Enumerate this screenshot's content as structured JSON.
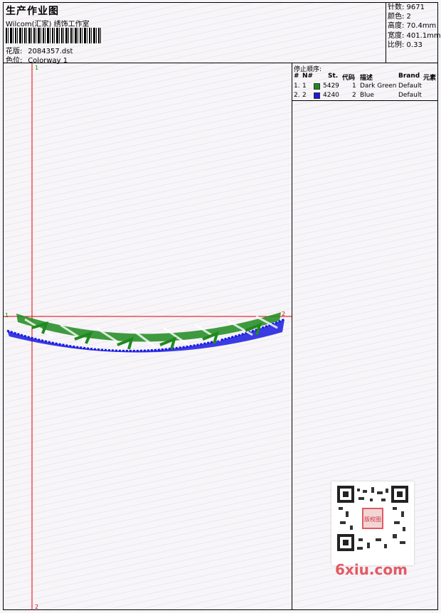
{
  "header": {
    "title": "生产作业图",
    "company": "Wilcom(汇家) 绣饰工作室",
    "design_label": "花版:",
    "design_value": "2084357.dst",
    "colorway_label": "色位:",
    "colorway_value": "Colorway 1"
  },
  "stats": {
    "stitches": "针数: 9671",
    "colors": "颜色: 2",
    "height": "高度: 70.4mm",
    "width": "宽度: 401.1mm",
    "scale": "比例: 0.33"
  },
  "canvas": {
    "marker_top": "1",
    "marker_bottom": "2",
    "marker_left": "1",
    "marker_right": "2"
  },
  "stop_sequence": {
    "title": "停止顺序:",
    "columns": [
      "#",
      "N#",
      "St.",
      "代码",
      "描述",
      "Brand",
      "元素"
    ],
    "rows": [
      {
        "idx": "1.",
        "n": "1",
        "color": "#1f8a1f",
        "st": "5429",
        "code": "1",
        "desc": "Dark Green",
        "brand": "Default"
      },
      {
        "idx": "2.",
        "n": "2",
        "color": "#1a1ae0",
        "st": "4240",
        "code": "2",
        "desc": "Blue",
        "brand": "Default"
      }
    ]
  },
  "watermark": {
    "stamp": "版权图",
    "site": "6xiu.com"
  }
}
